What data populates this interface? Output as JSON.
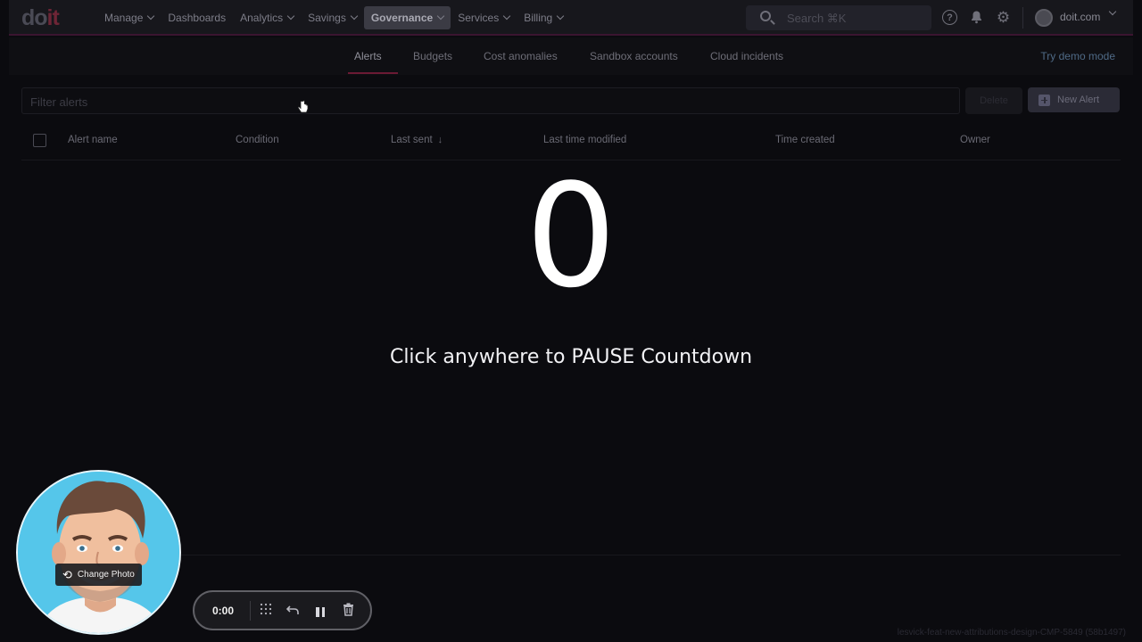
{
  "header": {
    "logo": "doit",
    "nav": [
      {
        "label": "Manage",
        "has_menu": true,
        "active": false
      },
      {
        "label": "Dashboards",
        "has_menu": false,
        "active": false
      },
      {
        "label": "Analytics",
        "has_menu": true,
        "active": false
      },
      {
        "label": "Savings",
        "has_menu": true,
        "active": false
      },
      {
        "label": "Governance",
        "has_menu": true,
        "active": true
      },
      {
        "label": "Services",
        "has_menu": true,
        "active": false
      },
      {
        "label": "Billing",
        "has_menu": true,
        "active": false
      }
    ],
    "search_placeholder": "Search ⌘K",
    "account": "doit.com"
  },
  "subnav": {
    "tabs": [
      {
        "label": "Alerts",
        "active": true
      },
      {
        "label": "Budgets",
        "active": false
      },
      {
        "label": "Cost anomalies",
        "active": false
      },
      {
        "label": "Sandbox accounts",
        "active": false
      },
      {
        "label": "Cloud incidents",
        "active": false
      }
    ],
    "demo_link": "Try demo mode"
  },
  "toolbar": {
    "filter_placeholder": "Filter alerts",
    "delete_label": "Delete",
    "new_label": "New Alert"
  },
  "table": {
    "columns": [
      "Alert name",
      "Condition",
      "Last sent",
      "Last time modified",
      "Time created",
      "Owner"
    ]
  },
  "overlay": {
    "countdown": "0",
    "hint": "Click anywhere to PAUSE Countdown"
  },
  "webcam": {
    "change_photo_label": "Change Photo"
  },
  "recorder": {
    "time": "0:00"
  },
  "footer": {
    "branch": "lesvick-feat-new-attributions-design-CMP-5849 (58b1497)"
  },
  "colors": {
    "accent": "#6b1a34",
    "background": "#0b0b0f",
    "webcam_bg": "#4fc3e8"
  }
}
